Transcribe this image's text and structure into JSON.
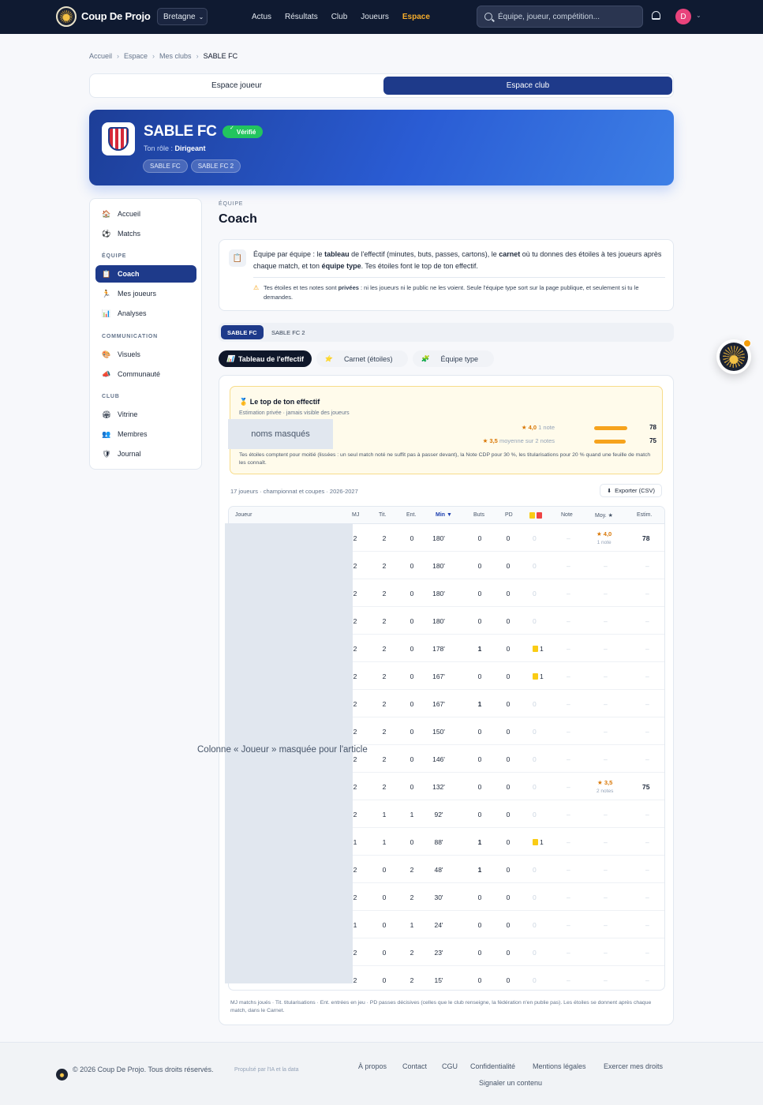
{
  "nav": {
    "brand": "Coup De Projo",
    "region": "Bretagne",
    "links": [
      "Actus",
      "Résultats",
      "Club",
      "Joueurs",
      "Espace"
    ],
    "active_link": "Espace",
    "search_placeholder": "Équipe, joueur, compétition...",
    "avatar_letter": "D"
  },
  "breadcrumb": [
    "Accueil",
    "Espace",
    "Mes clubs",
    "SABLE FC"
  ],
  "space_switch": {
    "player": "Espace joueur",
    "club": "Espace club"
  },
  "club": {
    "name": "SABLE FC",
    "verified": "Vérifié",
    "role_label": "Ton rôle : ",
    "role": "Dirigeant",
    "teams": [
      "SABLE FC",
      "SABLE FC 2"
    ]
  },
  "sidebar": {
    "items_top": [
      {
        "icon": "🏠",
        "label": "Accueil"
      },
      {
        "icon": "⚽",
        "label": "Matchs"
      }
    ],
    "section_team": "ÉQUIPE",
    "items_team": [
      {
        "icon": "📋",
        "label": "Coach"
      },
      {
        "icon": "🏃",
        "label": "Mes joueurs"
      },
      {
        "icon": "📊",
        "label": "Analyses"
      }
    ],
    "section_comm": "COMMUNICATION",
    "items_comm": [
      {
        "icon": "🎨",
        "label": "Visuels"
      },
      {
        "icon": "📣",
        "label": "Communauté"
      }
    ],
    "section_club": "CLUB",
    "items_club": [
      {
        "icon": "🏟",
        "label": "Vitrine"
      },
      {
        "icon": "👥",
        "label": "Membres"
      },
      {
        "icon": "🛡",
        "label": "Journal"
      }
    ]
  },
  "main": {
    "eyebrow": "ÉQUIPE",
    "title": "Coach",
    "info_1": "Équipe par équipe : le ",
    "info_b1": "tableau",
    "info_2": " de l'effectif (minutes, buts, passes, cartons), le ",
    "info_b2": "carnet",
    "info_3": " où tu donnes des étoiles à tes joueurs après chaque match, et ton ",
    "info_b3": "équipe type",
    "info_4": ". Tes étoiles font le top de ton effectif.",
    "warn_1": "Tes étoiles et tes notes sont ",
    "warn_b": "privées",
    "warn_2": " : ni les joueurs ni le public ne les voient. Seule l'équipe type sort sur la page publique, et seulement si tu le demandes.",
    "team_tabs": [
      "SABLE FC",
      "SABLE FC 2"
    ],
    "view_tabs": [
      {
        "icon": "📊",
        "label": "Tableau de l'effectif"
      },
      {
        "icon": "⭐",
        "label": "Carnet (étoiles)"
      },
      {
        "icon": "🧩",
        "label": "Équipe type"
      }
    ]
  },
  "top_box": {
    "title": "🥇 Le top de ton effectif",
    "subtitle": "Estimation privée · jamais visible des joueurs",
    "masked": "noms masqués",
    "ranks": [
      {
        "stars": "★ 4,0",
        "meta": "1 note",
        "score": "78",
        "fill": 1.0
      },
      {
        "stars": "★ 3,5",
        "meta": "moyenne sur 2 notes",
        "score": "75",
        "fill": 0.96
      }
    ],
    "foot": "Tes étoiles comptent pour moitié (lissées : un seul match noté ne suffit pas à passer devant), la Note CDP pour 30 %, les titularisations pour 20 % quand une feuille de match les connaît."
  },
  "table": {
    "summary": "17 joueurs · championnat et coupes · 2026-2027",
    "export": "Exporter (CSV)",
    "headers": [
      "Joueur",
      "MJ",
      "Tit.",
      "Ent.",
      "Min ▼",
      "Buts",
      "PD",
      "",
      "Note",
      "Moy. ★",
      "Estim."
    ],
    "rows": [
      [
        "2",
        "2",
        "0",
        "180'",
        "0",
        "0",
        "0",
        "–",
        "★ 4,0",
        "1 note",
        "78"
      ],
      [
        "2",
        "2",
        "0",
        "180'",
        "0",
        "0",
        "0",
        "–",
        "–",
        "",
        "–"
      ],
      [
        "2",
        "2",
        "0",
        "180'",
        "0",
        "0",
        "0",
        "–",
        "–",
        "",
        "–"
      ],
      [
        "2",
        "2",
        "0",
        "180'",
        "0",
        "0",
        "0",
        "–",
        "–",
        "",
        "–"
      ],
      [
        "2",
        "2",
        "0",
        "178'",
        "1",
        "0",
        "1",
        "–",
        "–",
        "",
        "–"
      ],
      [
        "2",
        "2",
        "0",
        "167'",
        "0",
        "0",
        "1",
        "–",
        "–",
        "",
        "–"
      ],
      [
        "2",
        "2",
        "0",
        "167'",
        "1",
        "0",
        "0",
        "–",
        "–",
        "",
        "–"
      ],
      [
        "2",
        "2",
        "0",
        "150'",
        "0",
        "0",
        "0",
        "–",
        "–",
        "",
        "–"
      ],
      [
        "2",
        "2",
        "0",
        "146'",
        "0",
        "0",
        "0",
        "–",
        "–",
        "",
        "–"
      ],
      [
        "2",
        "2",
        "0",
        "132'",
        "0",
        "0",
        "0",
        "–",
        "★ 3,5",
        "2 notes",
        "75"
      ],
      [
        "2",
        "1",
        "1",
        "92'",
        "0",
        "0",
        "0",
        "–",
        "–",
        "",
        "–"
      ],
      [
        "1",
        "1",
        "0",
        "88'",
        "1",
        "0",
        "1",
        "–",
        "–",
        "",
        "–"
      ],
      [
        "2",
        "0",
        "2",
        "48'",
        "1",
        "0",
        "0",
        "–",
        "–",
        "",
        "–"
      ],
      [
        "2",
        "0",
        "2",
        "30'",
        "0",
        "0",
        "0",
        "–",
        "–",
        "",
        "–"
      ],
      [
        "1",
        "0",
        "1",
        "24'",
        "0",
        "0",
        "0",
        "–",
        "–",
        "",
        "–"
      ],
      [
        "2",
        "0",
        "2",
        "23'",
        "0",
        "0",
        "0",
        "–",
        "–",
        "",
        "–"
      ],
      [
        "2",
        "0",
        "2",
        "15'",
        "0",
        "0",
        "0",
        "–",
        "–",
        "",
        "–"
      ]
    ],
    "mask_label": "Colonne « Joueur » masquée pour l'article",
    "legend": "MJ matchs joués · Tit. titularisations · Ent. entrées en jeu · PD passes décisives (celles que le club renseigne, la fédération n'en publie pas). Les étoiles se donnent après chaque match, dans le Carnet."
  },
  "footer": {
    "copyright": "© 2026 Coup De Projo. Tous droits réservés.",
    "ai": "Propulsé par l'IA et la data",
    "links": [
      "À propos",
      "Contact",
      "CGU",
      "Confidentialité",
      "Mentions légales",
      "Exercer mes droits",
      "Signaler un contenu"
    ]
  },
  "colors": {
    "nav_bg": "#0f1a31",
    "accent": "#f6ad2b",
    "primary": "#1e3a8a",
    "verified": "#22c55e"
  }
}
